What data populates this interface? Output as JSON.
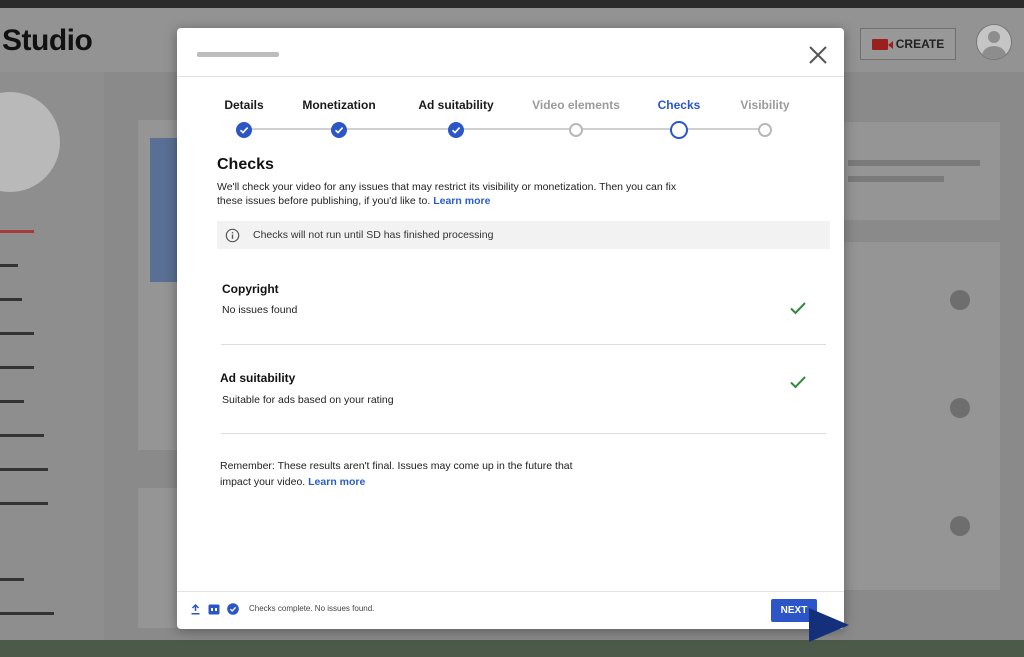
{
  "background": {
    "logo_text": "Studio",
    "create_label": "CREATE"
  },
  "modal": {
    "steps": [
      {
        "label": "Details",
        "state": "done"
      },
      {
        "label": "Monetization",
        "state": "done"
      },
      {
        "label": "Ad suitability",
        "state": "done"
      },
      {
        "label": "Video elements",
        "state": "pending"
      },
      {
        "label": "Checks",
        "state": "current"
      },
      {
        "label": "Visibility",
        "state": "pending"
      }
    ],
    "title": "Checks",
    "description": "We'll check your video for any issues that may restrict its visibility or monetization. Then you can fix these issues before publishing, if you'd like to.",
    "learn_more": "Learn more",
    "info_text": "Checks will not run until SD has finished processing",
    "checks": [
      {
        "title": "Copyright",
        "subtitle": "No issues found"
      },
      {
        "title": "Ad suitability",
        "subtitle": "Suitable for ads based on your rating"
      }
    ],
    "remember_text": "Remember: These results aren't final. Issues may come up in the future that impact your video.",
    "remember_link": "Learn more",
    "footer_status": "Checks complete. No issues found.",
    "next_label": "NEXT"
  },
  "colors": {
    "accent": "#2c56c7",
    "check_green": "#2e8b3a",
    "link": "#2a5dc8"
  }
}
